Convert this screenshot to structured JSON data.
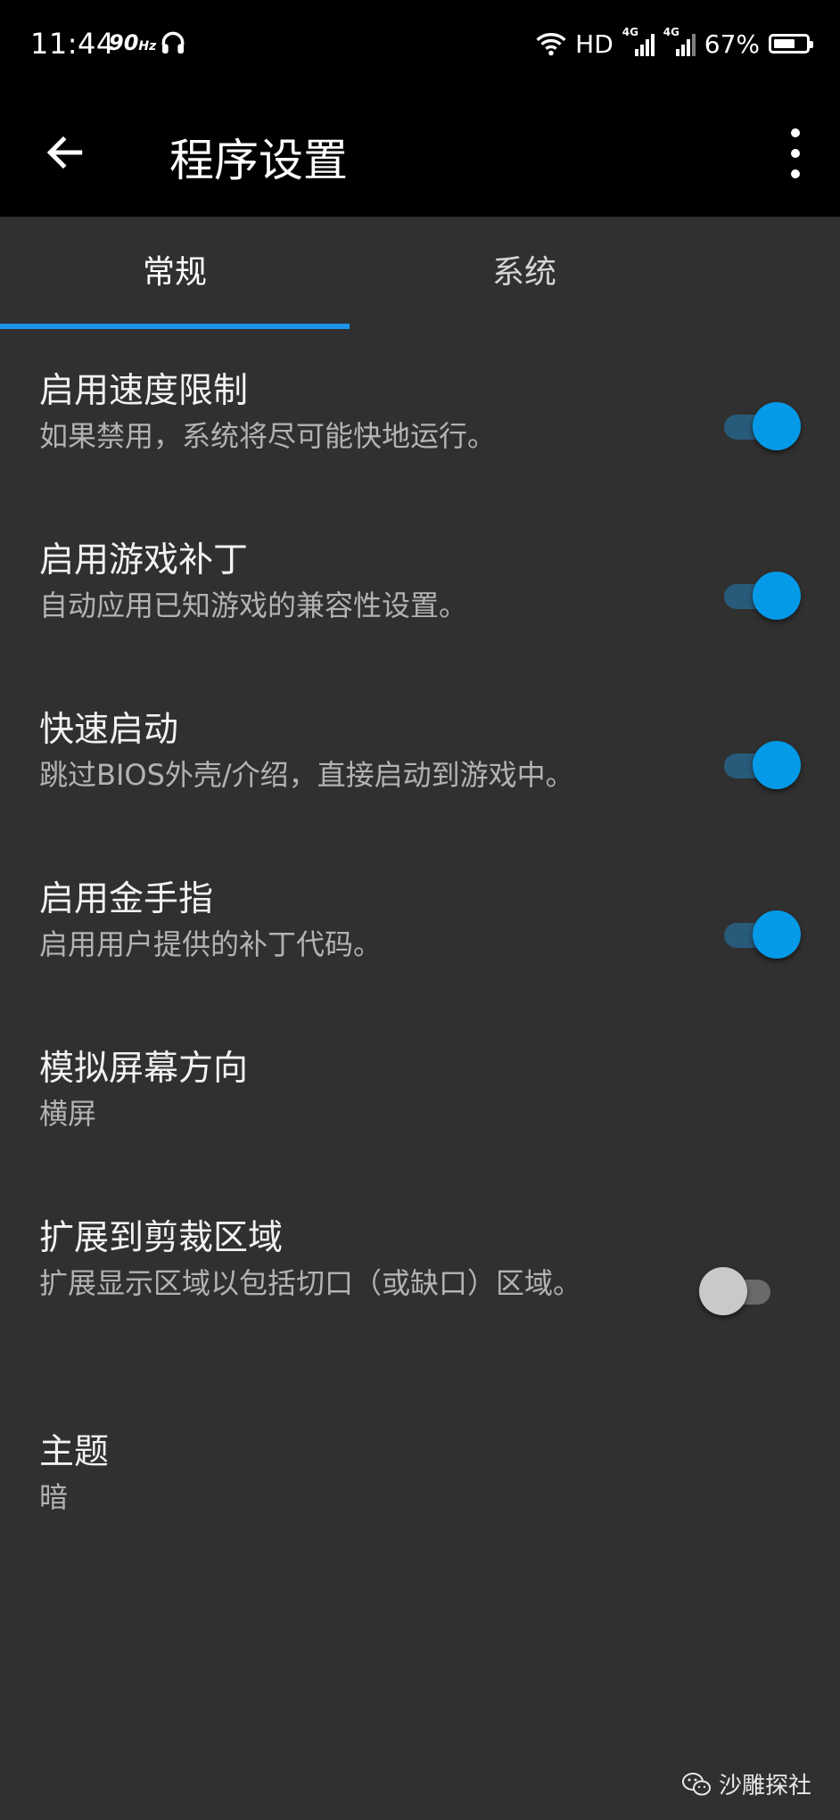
{
  "status_bar": {
    "time": "11:44",
    "refresh": "90",
    "refresh_unit": "Hz",
    "hd": "HD",
    "sig1": "4G",
    "sig2": "4G",
    "battery": "67%",
    "battery_level": 0.67
  },
  "app_bar": {
    "title": "程序设置"
  },
  "tabs": [
    {
      "label": "常规",
      "selected": true
    },
    {
      "label": "系统",
      "selected": false
    }
  ],
  "settings": [
    {
      "title": "启用速度限制",
      "subtitle": "如果禁用，系统将尽可能快地运行。",
      "toggle": true
    },
    {
      "title": "启用游戏补丁",
      "subtitle": "自动应用已知游戏的兼容性设置。",
      "toggle": true
    },
    {
      "title": "快速启动",
      "subtitle": "跳过BIOS外壳/介绍，直接启动到游戏中。",
      "toggle": true
    },
    {
      "title": "启用金手指",
      "subtitle": "启用用户提供的补丁代码。",
      "toggle": true
    },
    {
      "title": "模拟屏幕方向",
      "subtitle": "横屏"
    },
    {
      "title": "扩展到剪裁区域",
      "subtitle": "扩展显示区域以包括切口（或缺口）区域。",
      "toggle": false
    },
    {
      "title": "主题",
      "subtitle": "暗"
    }
  ],
  "watermark": {
    "text": "沙雕探社"
  },
  "colors": {
    "accent": "#049ae7",
    "tab_indicator": "#1e95e8",
    "background": "#303030",
    "appbar": "#000000"
  }
}
